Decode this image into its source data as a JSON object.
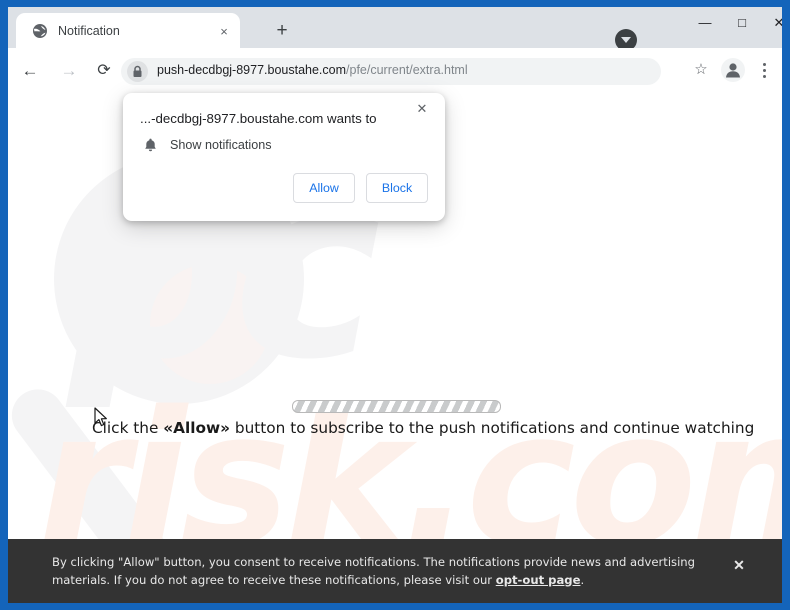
{
  "browser": {
    "tab": {
      "title": "Notification",
      "favicon_icon": "globe-icon",
      "close_icon": "×"
    },
    "new_tab_icon": "+",
    "window_controls": {
      "caret_icon": "caret-down-icon",
      "minimize": "—",
      "maximize": "□",
      "close": "✕"
    },
    "toolbar": {
      "back_icon": "←",
      "forward_icon": "→",
      "reload_icon": "⟳",
      "lock_icon": "lock-icon",
      "url_host": "push-decdbgj-8977.boustahe.com",
      "url_path": "/pfe/current/extra.html",
      "bookmark_icon": "☆",
      "profile_icon": "person-icon",
      "menu_icon": "three-dots-icon"
    }
  },
  "dialog": {
    "origin": "...-decdbgj-8977.boustahe.com wants to",
    "permission_icon": "bell-icon",
    "permission_label": "Show notifications",
    "allow_label": "Allow",
    "block_label": "Block",
    "close_icon": "✕"
  },
  "page": {
    "instruction_prefix": "Click the ",
    "instruction_allow": "«Allow»",
    "instruction_suffix": " button to subscribe to the push notifications and continue watching",
    "watermark_primary": "pc",
    "watermark_secondary": "risk.com",
    "progress_label": "striped-progress-bar"
  },
  "banner": {
    "line1": "By clicking \"Allow\" button, you consent to receive notifications. The notifications provide news and advertising materials. If",
    "line2_before": "you do not agree to receive these notifications, please visit our ",
    "link": "opt-out page",
    "line2_after": ".",
    "close_icon": "✕",
    "background_color": "#333333"
  },
  "colors": {
    "frame_blue": "#1464ba",
    "accent_blue": "#1a73e8",
    "banner_dark": "#333333"
  }
}
